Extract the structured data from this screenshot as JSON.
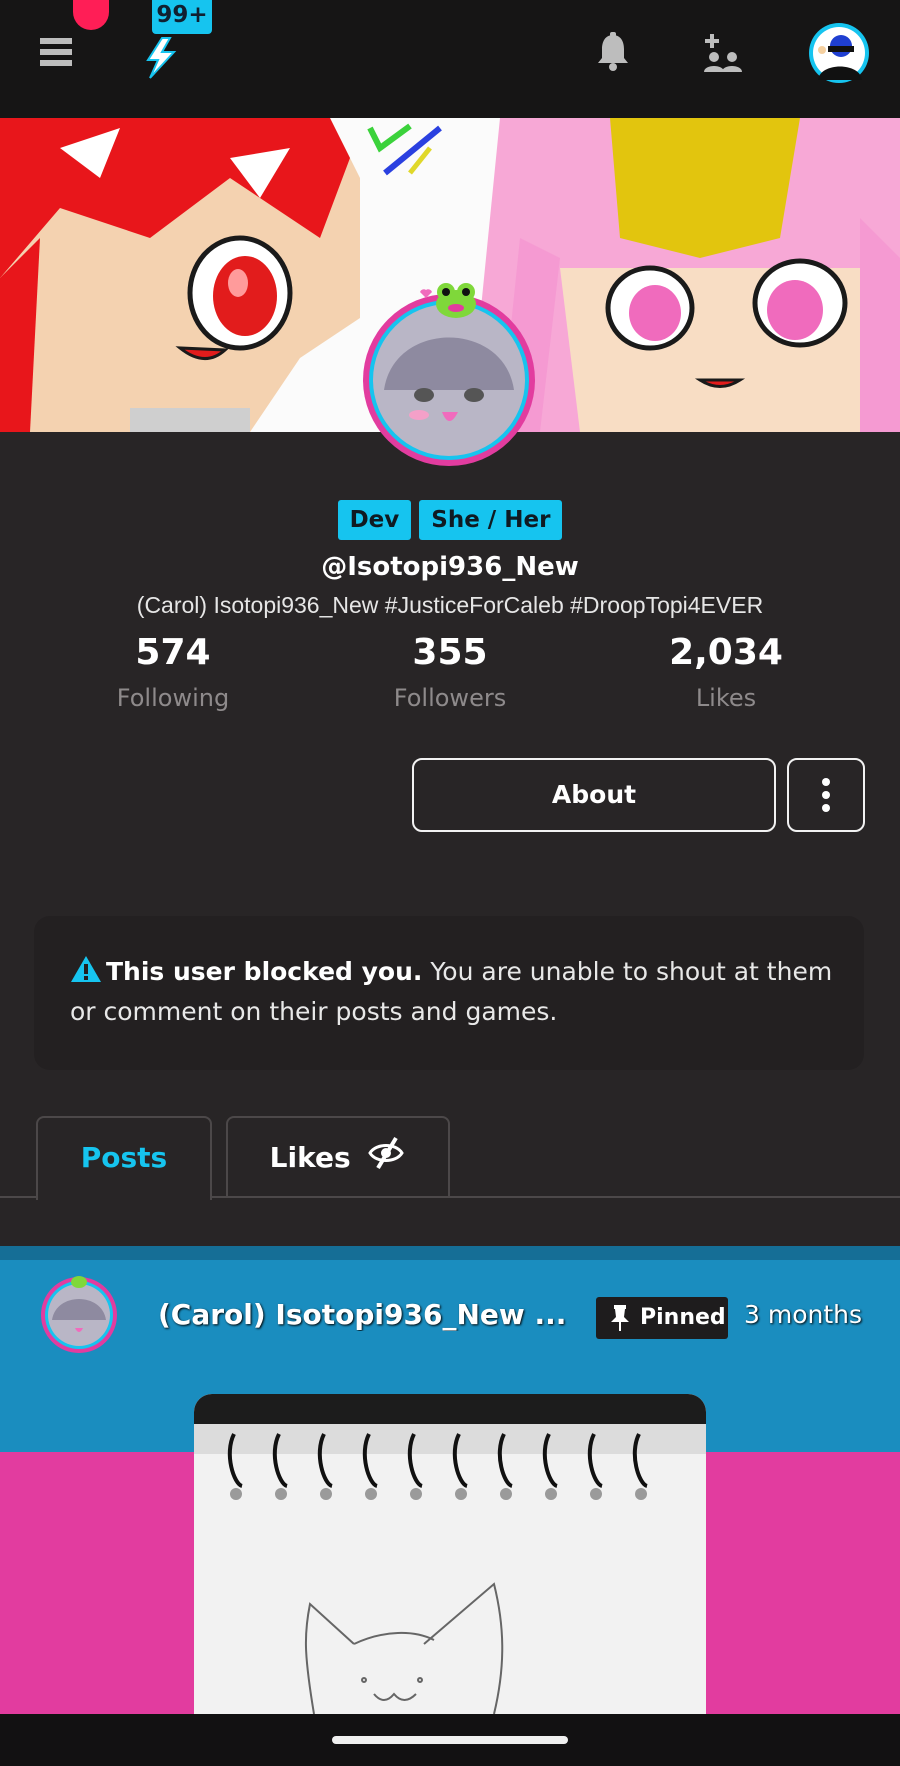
{
  "topbar": {
    "notification_count": "99+",
    "colors": {
      "badge": "#16c4ef",
      "record_dot": "#ff1e56",
      "bar": "#161515"
    }
  },
  "profile": {
    "tags": [
      "Dev",
      "She / Her"
    ],
    "handle": "@Isotopi936_New",
    "bio": "(Carol) Isotopi936_New #JusticeForCaleb #DroopTopi4EVER",
    "stats": [
      {
        "value": "574",
        "label": "Following"
      },
      {
        "value": "355",
        "label": "Followers"
      },
      {
        "value": "2,034",
        "label": "Likes"
      }
    ],
    "about_label": "About"
  },
  "notice": {
    "bold": "This user blocked you.",
    "text": " You are unable to shout at them or comment on their posts and games."
  },
  "tabs": [
    {
      "label": "Posts",
      "active": true
    },
    {
      "label": "Likes",
      "active": false
    }
  ],
  "post": {
    "author": "(Carol) Isotopi936_New ...",
    "pinned_label": "Pinned",
    "time": "3 months"
  },
  "colors": {
    "accent": "#16c4ef",
    "background": "#282526",
    "post_blue": "#1a8dbf",
    "post_pink": "#e23c9f"
  }
}
